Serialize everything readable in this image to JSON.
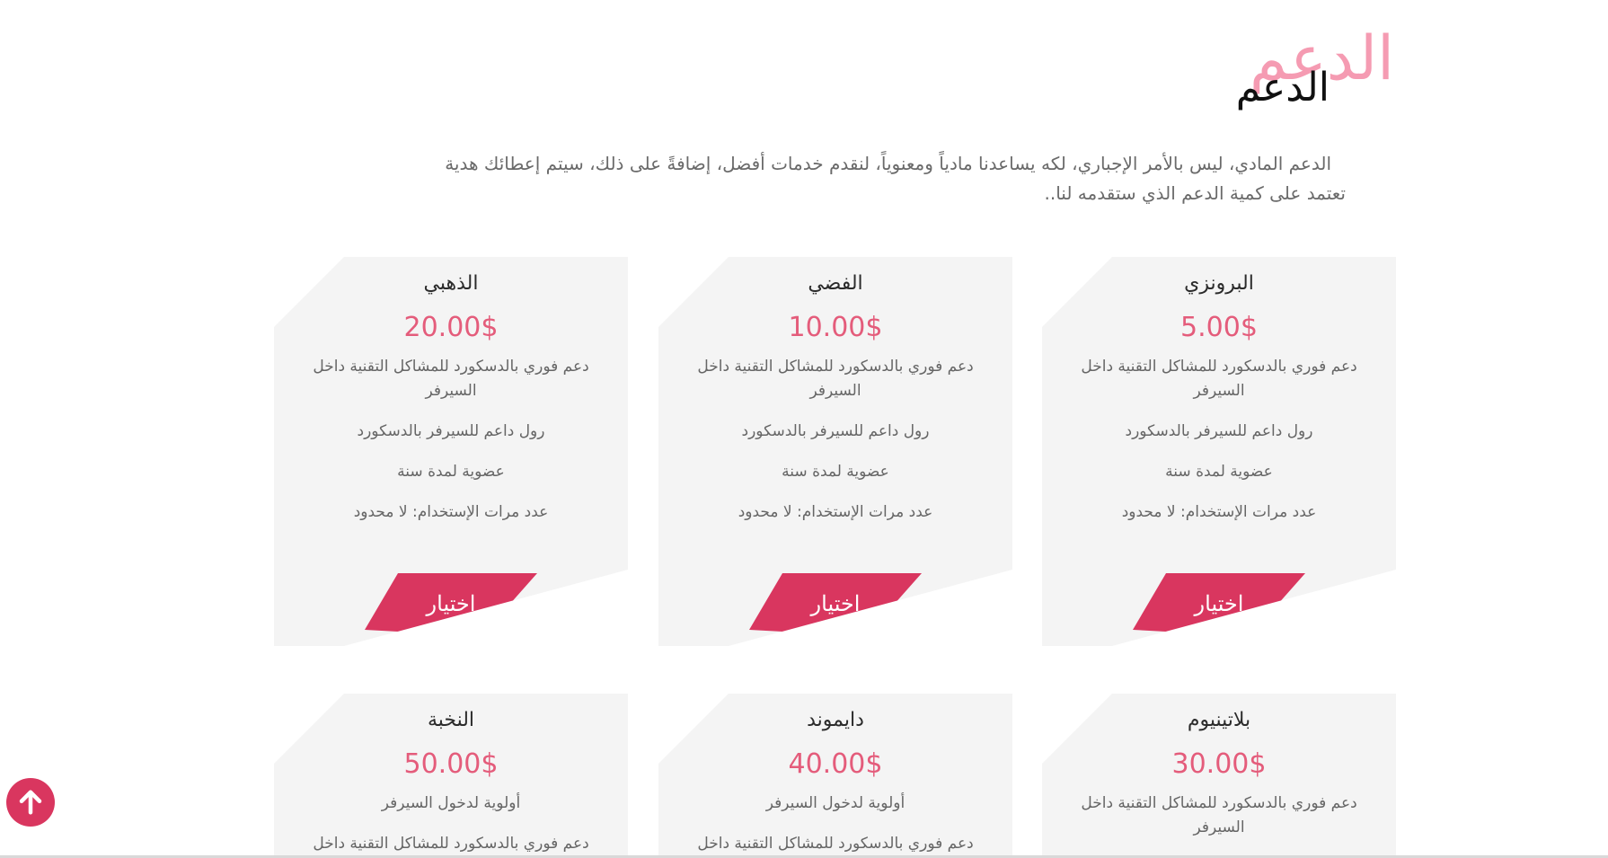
{
  "section": {
    "title_shadow": "الدعم",
    "title": "الدعم",
    "intro_line1": "الدعم المادي، ليس بالأمر الإجباري، لكه يساعدنا مادياً ومعنوياً، لنقدم خدمات أفضل، إضافةً على ذلك، سيتم إعطائك هدية",
    "intro_line2": "تعتمد على كمية الدعم الذي ستقدمه لنا.."
  },
  "plans": [
    {
      "name": "البرونزي",
      "price": "5.00$",
      "features": [
        "دعم فوري بالدسكورد للمشاكل التقنية داخل السيرفر",
        "رول داعم للسيرفر بالدسكورد",
        "عضوية لمدة سنة",
        "عدد مرات الإستخدام: لا محدود"
      ],
      "button": "إختيار"
    },
    {
      "name": "الفضي",
      "price": "10.00$",
      "features": [
        "دعم فوري بالدسكورد للمشاكل التقنية داخل السيرفر",
        "رول داعم للسيرفر بالدسكورد",
        "عضوية لمدة سنة",
        "عدد مرات الإستخدام: لا محدود"
      ],
      "button": "إختيار"
    },
    {
      "name": "الذهبي",
      "price": "20.00$",
      "features": [
        "دعم فوري بالدسكورد للمشاكل التقنية داخل السيرفر",
        "رول داعم للسيرفر بالدسكورد",
        "عضوية لمدة سنة",
        "عدد مرات الإستخدام: لا محدود"
      ],
      "button": "إختيار"
    },
    {
      "name": "بلاتينيوم",
      "price": "30.00$",
      "features": [
        "دعم فوري بالدسكورد للمشاكل التقنية داخل السيرفر"
      ]
    },
    {
      "name": "دايموند",
      "price": "40.00$",
      "features": [
        "أولوية لدخول السيرفر",
        "دعم فوري بالدسكورد للمشاكل التقنية داخل"
      ]
    },
    {
      "name": "النخبة",
      "price": "50.00$",
      "features": [
        "أولوية لدخول السيرفر",
        "دعم فوري بالدسكورد للمشاكل التقنية داخل"
      ]
    }
  ],
  "scroll_top": {
    "icon": "arrow-up-icon"
  },
  "colors": {
    "accent": "#d9365f",
    "price": "#e45c7b",
    "title_shadow": "#f48aa5",
    "card_bg": "#f4f4f4"
  }
}
